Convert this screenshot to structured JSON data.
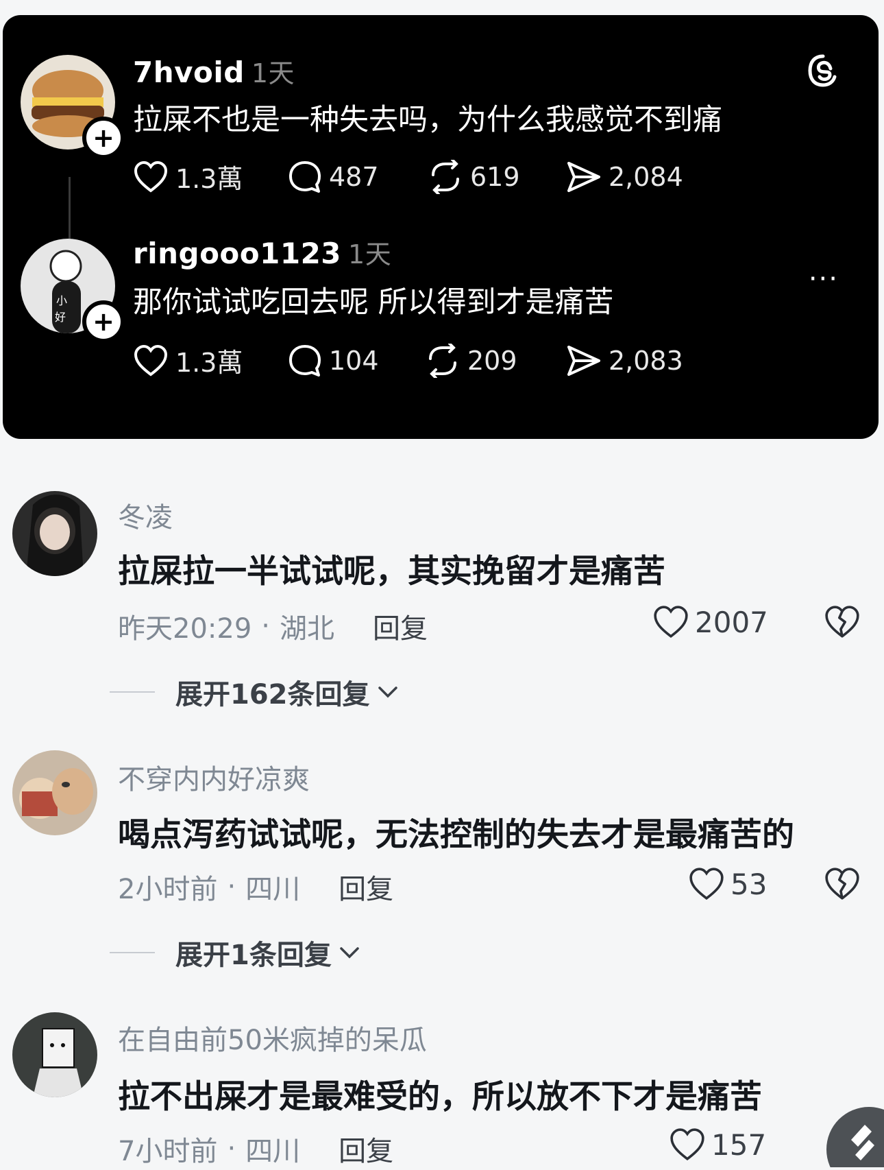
{
  "threads": {
    "posts": [
      {
        "username": "7hvoid",
        "time": "1天",
        "text": "拉屎不也是一种失去吗，为什么我感觉不到痛",
        "likes": "1.3萬",
        "comments": "487",
        "reposts": "619",
        "shares": "2,084"
      },
      {
        "username": "ringooo1123",
        "time": "1天",
        "text": "那你试试吃回去呢 所以得到才是痛苦",
        "likes": "1.3萬",
        "comments": "104",
        "reposts": "209",
        "shares": "2,083"
      }
    ],
    "more_label": "···",
    "plus_label": "+"
  },
  "comments": [
    {
      "name": "冬凌",
      "text": "拉屎拉一半试试呢，其实挽留才是痛苦",
      "time": "昨天20:29",
      "location": "湖北",
      "reply_label": "回复",
      "likes": "2007",
      "expand_label": "展开162条回复"
    },
    {
      "name": "不穿内内好凉爽",
      "text": "喝点泻药试试呢，无法控制的失去才是最痛苦的",
      "time": "2小时前",
      "location": "四川",
      "reply_label": "回复",
      "likes": "53",
      "expand_label": "展开1条回复"
    },
    {
      "name": "在自由前50米疯掉的呆瓜",
      "text": "拉不出屎才是最难受的，所以放不下才是痛苦",
      "time": "7小时前",
      "location": "四川",
      "reply_label": "回复",
      "likes": "157"
    }
  ],
  "meta_separator": "·"
}
